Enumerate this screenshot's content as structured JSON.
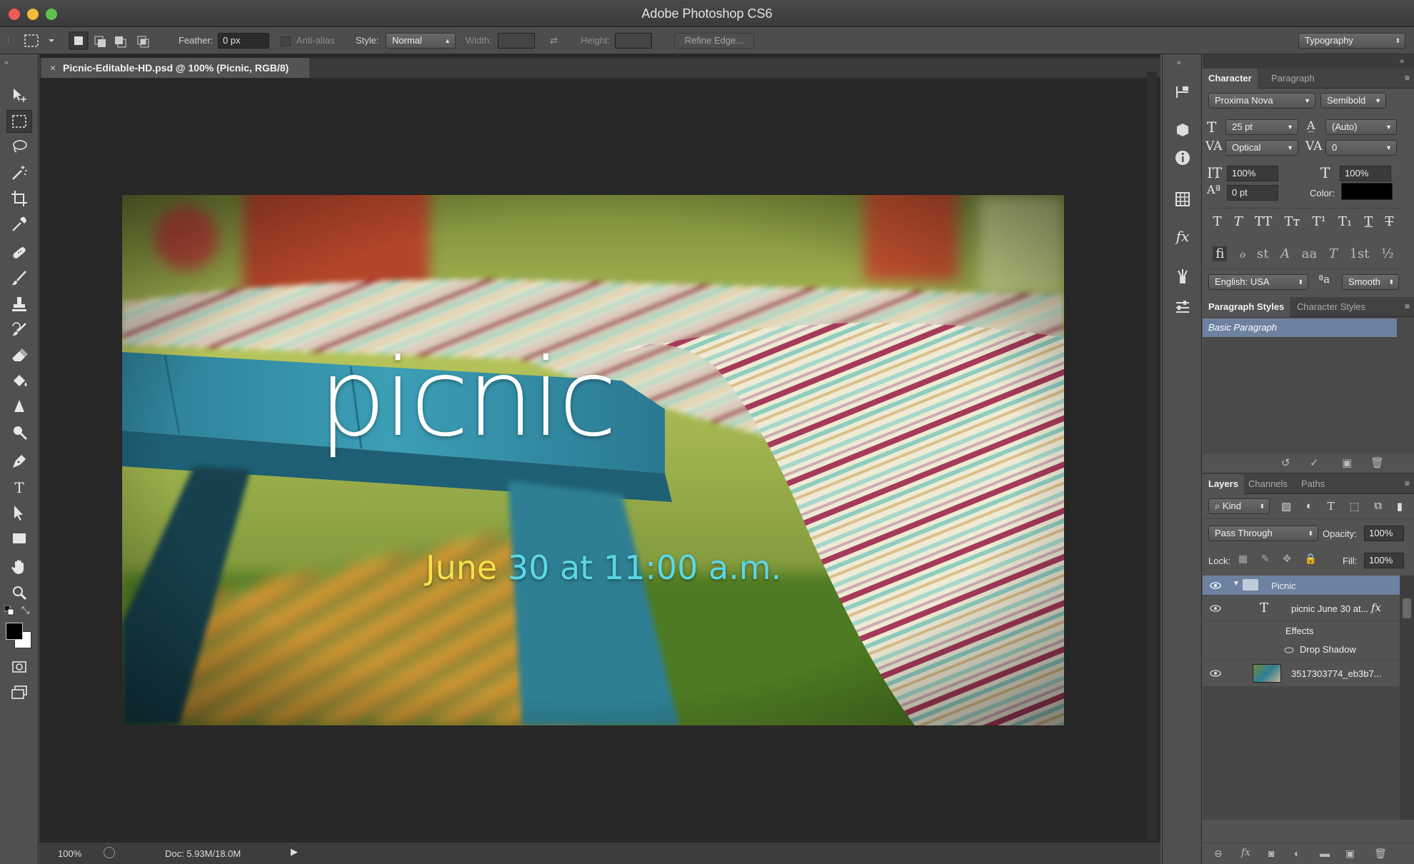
{
  "app": {
    "title": "Adobe Photoshop CS6"
  },
  "options": {
    "feather_label": "Feather:",
    "feather_value": "0 px",
    "antialias_label": "Anti-alias",
    "style_label": "Style:",
    "style_value": "Normal",
    "width_label": "Width:",
    "height_label": "Height:",
    "refine_edge": "Refine Edge...",
    "workspace": "Typography"
  },
  "document": {
    "tab_title": "Picnic-Editable-HD.psd @ 100% (Picnic, RGB/8)",
    "headline": "picnic",
    "date_part1": "June",
    "date_part2": "30 at 11:00 a.m."
  },
  "status": {
    "zoom": "100%",
    "doc": "Doc: 5.93M/18.0M"
  },
  "character": {
    "tab1": "Character",
    "tab2": "Paragraph",
    "font_family": "Proxima Nova",
    "font_style": "Semibold",
    "size": "25 pt",
    "leading": "(Auto)",
    "kerning": "Optical",
    "tracking": "0",
    "vscale": "100%",
    "hscale": "100%",
    "baseline": "0 pt",
    "color_label": "Color:",
    "language": "English: USA",
    "antialias": "Smooth"
  },
  "styles": {
    "tab1": "Paragraph Styles",
    "tab2": "Character Styles",
    "item": "Basic Paragraph"
  },
  "layers": {
    "tab1": "Layers",
    "tab2": "Channels",
    "tab3": "Paths",
    "kind": "Kind",
    "blend": "Pass Through",
    "opacity_label": "Opacity:",
    "opacity": "100%",
    "lock_label": "Lock:",
    "fill_label": "Fill:",
    "fill": "100%",
    "items": [
      {
        "name": "Picnic"
      },
      {
        "name": "picnic June 30 at..."
      },
      {
        "name": "Effects"
      },
      {
        "name": "Drop Shadow"
      },
      {
        "name": "3517303774_eb3b7..."
      }
    ]
  },
  "colors": {
    "accent_cyan": "#5ad7e6",
    "date_yellow": "#f4e14a",
    "selected_row": "#6d82a0"
  }
}
